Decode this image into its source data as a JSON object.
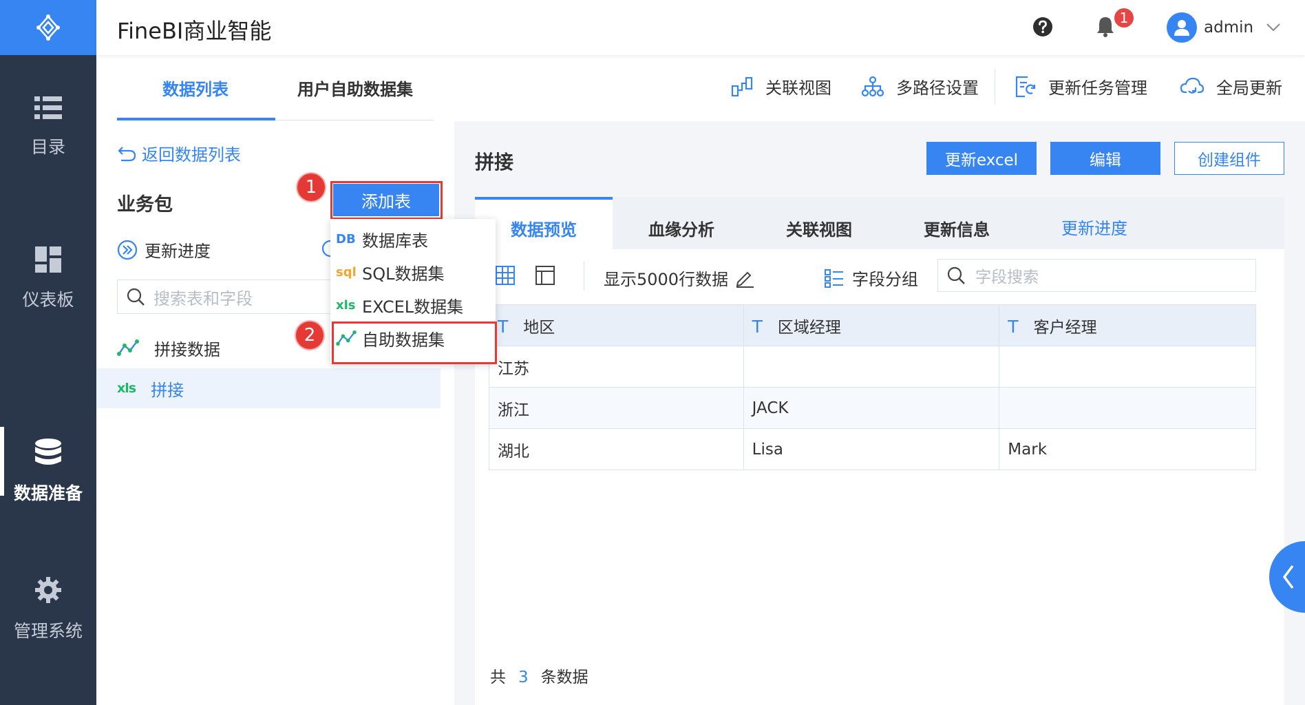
{
  "app": {
    "title": "FineBI商业智能",
    "accent": "#3685f2"
  },
  "header": {
    "notification_count": "1",
    "user_name": "admin",
    "help_icon": "question-circle-icon",
    "bell_icon": "bell-icon"
  },
  "rail": {
    "items": [
      {
        "label": "目录",
        "icon": "list-icon"
      },
      {
        "label": "仪表板",
        "icon": "dashboard-icon"
      },
      {
        "label": "数据准备",
        "icon": "database-icon",
        "active": true
      },
      {
        "label": "管理系统",
        "icon": "gear-icon"
      }
    ]
  },
  "subheader": {
    "tabs": [
      {
        "label": "数据列表",
        "active": true
      },
      {
        "label": "用户自助数据集"
      }
    ],
    "actions": [
      {
        "label": "关联视图",
        "icon": "relation-view-icon"
      },
      {
        "label": "多路径设置",
        "icon": "multi-path-icon"
      },
      {
        "label": "更新任务管理",
        "icon": "update-task-icon"
      },
      {
        "label": "全局更新",
        "icon": "cloud-refresh-icon"
      }
    ]
  },
  "left": {
    "back_label": "返回数据列表",
    "package_title": "业务包",
    "refresh_progress": "更新进度",
    "search_placeholder": "搜索表和字段",
    "tree": [
      {
        "label": "拼接数据",
        "icon": "self-service-dataset-icon"
      },
      {
        "label": "拼接",
        "icon": "xls-icon",
        "selected": true
      }
    ]
  },
  "add_table": {
    "button_label": "添加表",
    "menu": [
      {
        "icon_text": "DB",
        "label": "数据库表"
      },
      {
        "icon_text": "sql",
        "label": "SQL数据集"
      },
      {
        "icon_text": "xls",
        "label": "EXCEL数据集"
      },
      {
        "icon_text": "",
        "label": "自助数据集"
      }
    ],
    "steps": [
      "1",
      "2"
    ]
  },
  "dataset": {
    "title": "拼接",
    "buttons": {
      "update_excel": "更新excel",
      "edit": "编辑",
      "create_component": "创建组件"
    },
    "tabs": [
      {
        "label": "数据预览",
        "active": true
      },
      {
        "label": "血缘分析"
      },
      {
        "label": "关联视图"
      },
      {
        "label": "更新信息"
      },
      {
        "label": "更新进度",
        "link": true
      }
    ],
    "toolbar": {
      "show_rows": "显示5000行数据",
      "field_group": "字段分组",
      "field_search_placeholder": "字段搜索"
    },
    "table": {
      "type_marker": "T",
      "columns": [
        "地区",
        "区域经理",
        "客户经理"
      ],
      "rows": [
        [
          "江苏",
          "",
          ""
        ],
        [
          "浙江",
          "JACK",
          ""
        ],
        [
          "湖北",
          "Lisa",
          "Mark"
        ]
      ]
    },
    "footer": {
      "prefix": "共",
      "count": "3",
      "suffix": "条数据"
    }
  }
}
